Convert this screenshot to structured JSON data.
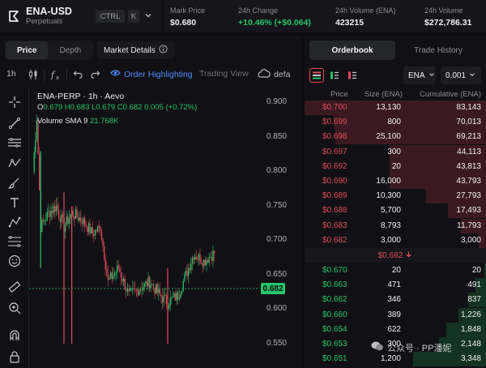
{
  "header": {
    "pair": "ENA-USD",
    "pair_type": "Perpetuals",
    "shortcut_ctrl": "CTRL",
    "shortcut_k": "K",
    "stats": [
      {
        "label": "Mark Price",
        "value": "$0.680",
        "color": "#f1f1f3"
      },
      {
        "label": "24h Change",
        "value": "+10.46% (+$0.064)",
        "color": "#27c46a"
      },
      {
        "label": "24h Volume (ENA)",
        "value": "423215",
        "color": "#f1f1f3"
      },
      {
        "label": "24h Volume",
        "value": "$272,786.31",
        "color": "#f1f1f3"
      }
    ]
  },
  "chart_tabs": {
    "price": "Price",
    "depth": "Depth",
    "market_details": "Market Details"
  },
  "toolbar": {
    "interval": "1h",
    "order_highlighting": "Order Highlighting",
    "trading_view": "Trading View",
    "default": "defa"
  },
  "legend": {
    "line1": "ENA-PERP · 1h · Aevo",
    "ohlc": "O0.679 H0.683 L0.679 C0.682 0.005 (+0.72%)",
    "volume_label": "Volume SMA 9",
    "volume_value": "21.768K"
  },
  "yaxis": {
    "ticks": [
      "0.900",
      "0.850",
      "0.800",
      "0.750",
      "0.700",
      "0.650",
      "0.600",
      "0.550"
    ],
    "current_price": "0.682"
  },
  "colors": {
    "up": "#27c46a",
    "down": "#e04a5a",
    "accent": "#4f8cff"
  },
  "orderbook": {
    "tabs": [
      "Orderbook",
      "Trade History"
    ],
    "asset": "ENA",
    "tick_size": "0.001",
    "headers": {
      "price": "Price",
      "size": "Size (ENA)",
      "cumulative": "Cumulative (ENA)"
    },
    "asks": [
      {
        "price": "$0.700",
        "size": "13,130",
        "cum": "83,143",
        "depth": 1.0
      },
      {
        "price": "$0.699",
        "size": "800",
        "cum": "70,013",
        "depth": 0.84
      },
      {
        "price": "$0.698",
        "size": "25,100",
        "cum": "69,213",
        "depth": 0.83
      },
      {
        "price": "$0.697",
        "size": "300",
        "cum": "44,113",
        "depth": 0.53
      },
      {
        "price": "$0.692",
        "size": "20",
        "cum": "43,813",
        "depth": 0.53
      },
      {
        "price": "$0.690",
        "size": "16,000",
        "cum": "43,793",
        "depth": 0.53
      },
      {
        "price": "$0.689",
        "size": "10,300",
        "cum": "27,793",
        "depth": 0.33
      },
      {
        "price": "$0.688",
        "size": "5,700",
        "cum": "17,493",
        "depth": 0.21
      },
      {
        "price": "$0.683",
        "size": "8,793",
        "cum": "11,793",
        "depth": 0.14
      },
      {
        "price": "$0.682",
        "size": "3,000",
        "cum": "3,000",
        "depth": 0.04
      }
    ],
    "mid_price": "$0.682",
    "bids": [
      {
        "price": "$0.670",
        "size": "20",
        "cum": "20",
        "depth": 0.01
      },
      {
        "price": "$0.663",
        "size": "471",
        "cum": "491",
        "depth": 0.06
      },
      {
        "price": "$0.662",
        "size": "346",
        "cum": "837",
        "depth": 0.1
      },
      {
        "price": "$0.660",
        "size": "389",
        "cum": "1,226",
        "depth": 0.15
      },
      {
        "price": "$0.654",
        "size": "622",
        "cum": "1,848",
        "depth": 0.22
      },
      {
        "price": "$0.653",
        "size": "300",
        "cum": "2,148",
        "depth": 0.26
      },
      {
        "price": "$0.651",
        "size": "1,200",
        "cum": "3,348",
        "depth": 0.4
      }
    ]
  },
  "watermark": "公众号 · PP潘妮"
}
